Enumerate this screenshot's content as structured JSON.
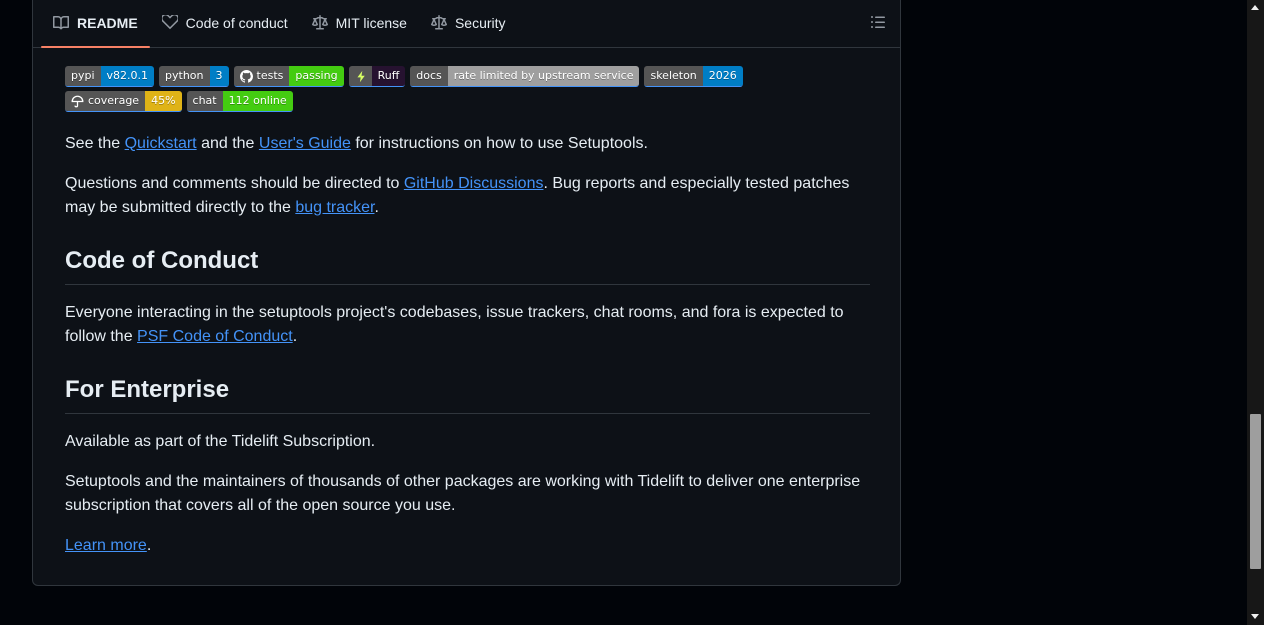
{
  "tabs": [
    {
      "label": "README",
      "icon": "book-icon",
      "active": true
    },
    {
      "label": "Code of conduct",
      "icon": "heart-icon"
    },
    {
      "label": "MIT license",
      "icon": "law-icon"
    },
    {
      "label": "Security",
      "icon": "law-icon"
    }
  ],
  "badges": [
    {
      "left": "pypi",
      "right": "v82.0.1",
      "color": "#007ec6"
    },
    {
      "left": "python",
      "right": "3",
      "color": "#007ec6"
    },
    {
      "left": "tests",
      "right": "passing",
      "color": "#4c1",
      "icon": "github-icon"
    },
    {
      "left": "",
      "right": "Ruff",
      "color": "#261230",
      "icon": "ruff-bolt-icon"
    },
    {
      "left": "docs",
      "right": "rate limited by upstream service",
      "color": "#9f9f9f"
    },
    {
      "left": "skeleton",
      "right": "2026",
      "color": "#007ec6"
    },
    {
      "left": "coverage",
      "right": "45%",
      "color": "#dfb317",
      "icon": "umbrella-icon"
    },
    {
      "left": "chat",
      "right": "112 online",
      "color": "#4c1"
    }
  ],
  "intro": {
    "t1": "See the ",
    "quickstart": "Quickstart",
    "t2": " and the ",
    "users_guide": "User's Guide",
    "t3": " for instructions on how to use Setuptools."
  },
  "questions": {
    "t1": "Questions and comments should be directed to ",
    "discussions": "GitHub Discussions",
    "t2": ". Bug reports and especially tested patches may be submitted directly to the ",
    "bug_tracker": "bug tracker",
    "t3": "."
  },
  "coc": {
    "heading": "Code of Conduct",
    "t1": "Everyone interacting in the setuptools project's codebases, issue trackers, chat rooms, and fora is expected to follow the ",
    "link": "PSF Code of Conduct",
    "t2": "."
  },
  "enterprise": {
    "heading": "For Enterprise",
    "p1": "Available as part of the Tidelift Subscription.",
    "p2": "Setuptools and the maintainers of thousands of other packages are working with Tidelift to deliver one enterprise subscription that covers all of the open source you use.",
    "learn_more": "Learn more",
    "t_end": "."
  }
}
